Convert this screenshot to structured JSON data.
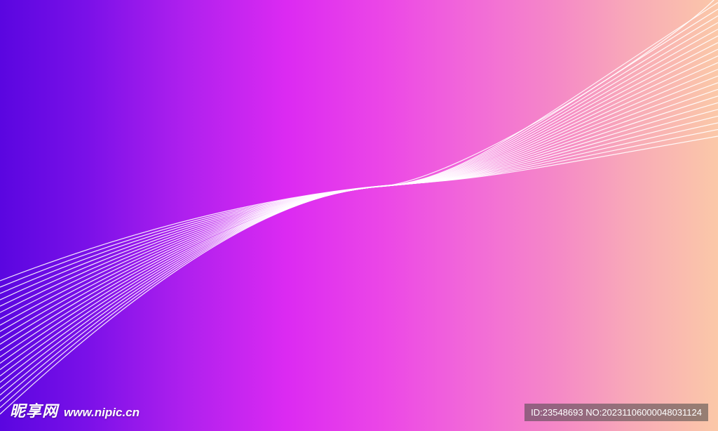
{
  "background": {
    "gradient_colors": [
      "#5a06e0",
      "#dc2af2",
      "#f26ad8",
      "#fbc8a8"
    ]
  },
  "wave": {
    "line_color": "#ffffff"
  },
  "watermark": {
    "logo_text": "昵享网",
    "url": "www.nipic.cn",
    "id_text": "ID:23548693 NO:20231106000048031124"
  }
}
